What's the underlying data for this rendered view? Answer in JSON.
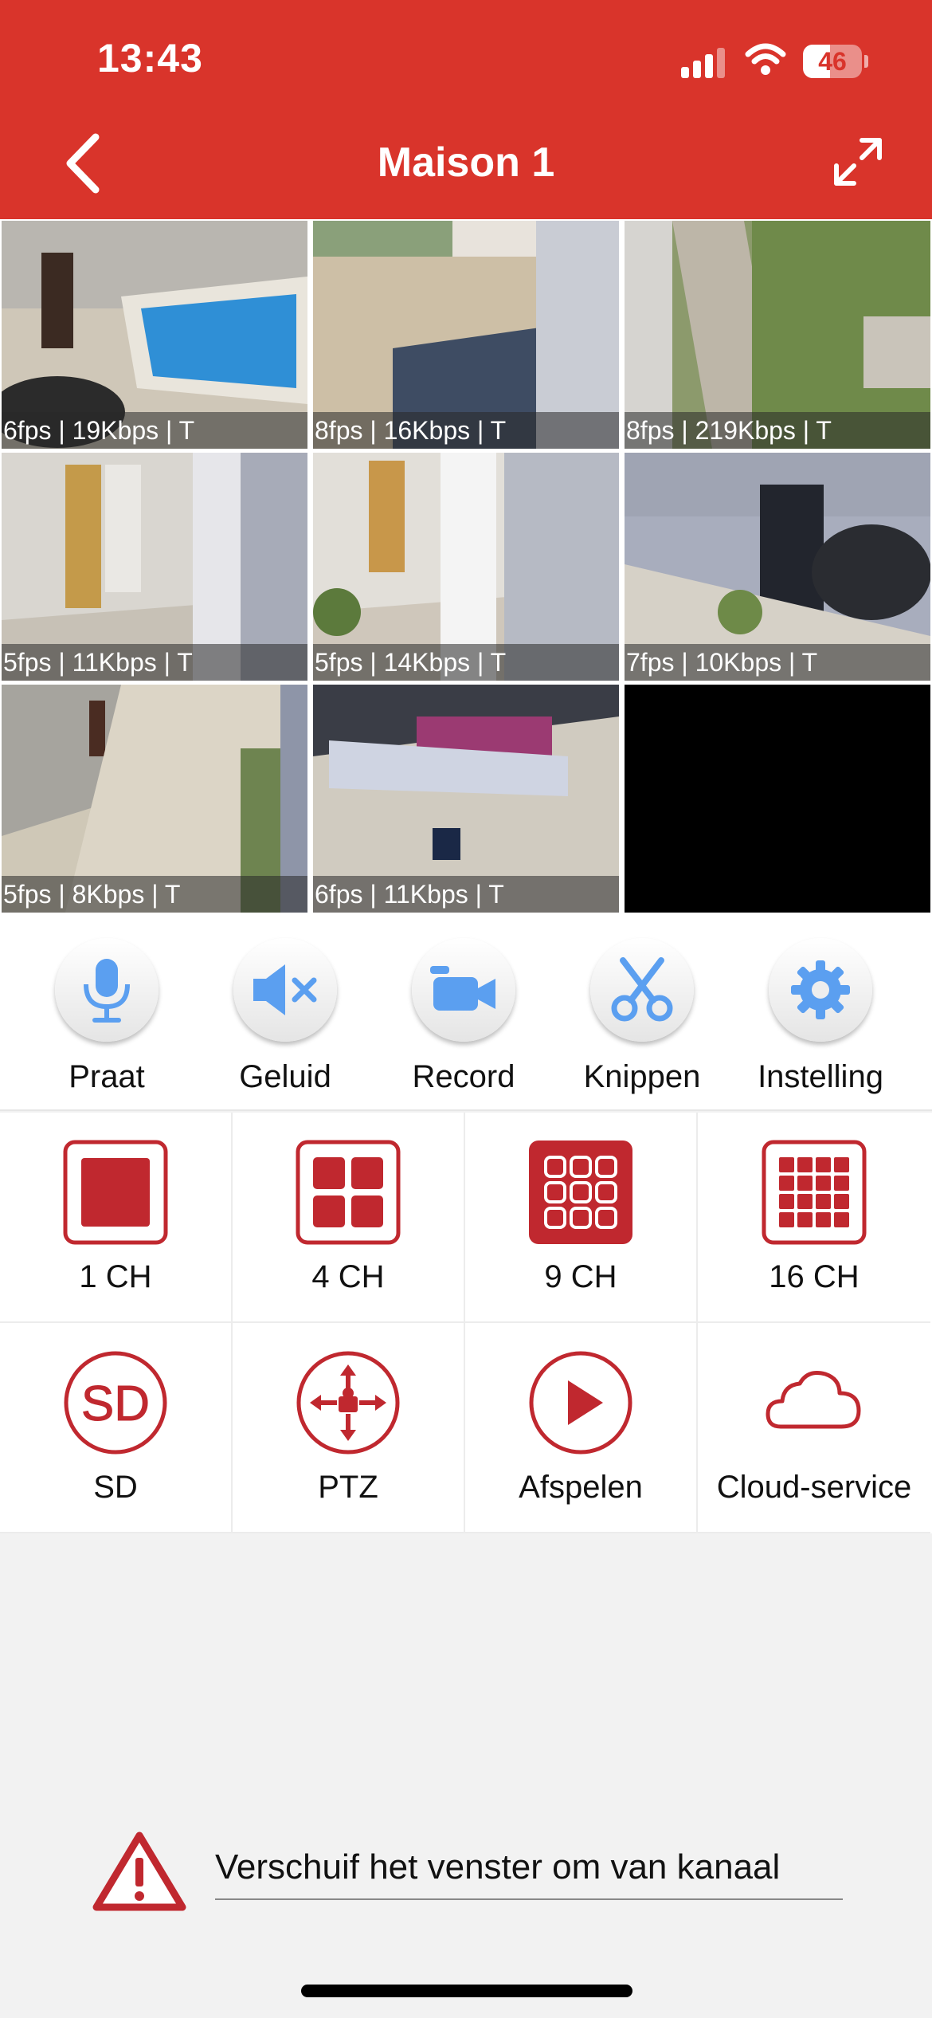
{
  "status_bar": {
    "time": "13:43",
    "battery": "46",
    "battery_level": 0.46
  },
  "header": {
    "title": "Maison 1"
  },
  "cameras": [
    {
      "label": "6fps | 19Kbps | T",
      "selected": true
    },
    {
      "label": "8fps | 16Kbps | T"
    },
    {
      "label": "8fps | 219Kbps | T"
    },
    {
      "label": "5fps | 11Kbps | T"
    },
    {
      "label": "5fps | 14Kbps | T"
    },
    {
      "label": "7fps | 10Kbps | T"
    },
    {
      "label": "5fps | 8Kbps | T"
    },
    {
      "label": "6fps | 11Kbps | T"
    },
    {
      "label": ""
    }
  ],
  "actions": [
    {
      "label": "Praat",
      "icon": "microphone-icon"
    },
    {
      "label": "Geluid",
      "icon": "speaker-mute-icon"
    },
    {
      "label": "Record",
      "icon": "video-camera-icon"
    },
    {
      "label": "Knippen",
      "icon": "scissors-icon"
    },
    {
      "label": "Instelling",
      "icon": "gear-icon"
    }
  ],
  "layouts": [
    {
      "label": "1 CH",
      "icon": "single-view-icon"
    },
    {
      "label": "4 CH",
      "icon": "quad-view-icon"
    },
    {
      "label": "9 CH",
      "icon": "nine-view-icon",
      "active": true
    },
    {
      "label": "16 CH",
      "icon": "sixteen-view-icon"
    }
  ],
  "features": [
    {
      "label": "SD",
      "icon": "sd-card-icon"
    },
    {
      "label": "PTZ",
      "icon": "ptz-control-icon"
    },
    {
      "label": "Afspelen",
      "icon": "play-icon"
    },
    {
      "label": "Cloud-service",
      "icon": "cloud-icon"
    }
  ],
  "hint": {
    "text": "Verschuif het venster om van kanaal"
  },
  "colors": {
    "brand_red": "#d9342b",
    "icon_red": "#c0282f",
    "icon_blue": "#5b9ff0",
    "selected_border": "#f2c75c"
  }
}
